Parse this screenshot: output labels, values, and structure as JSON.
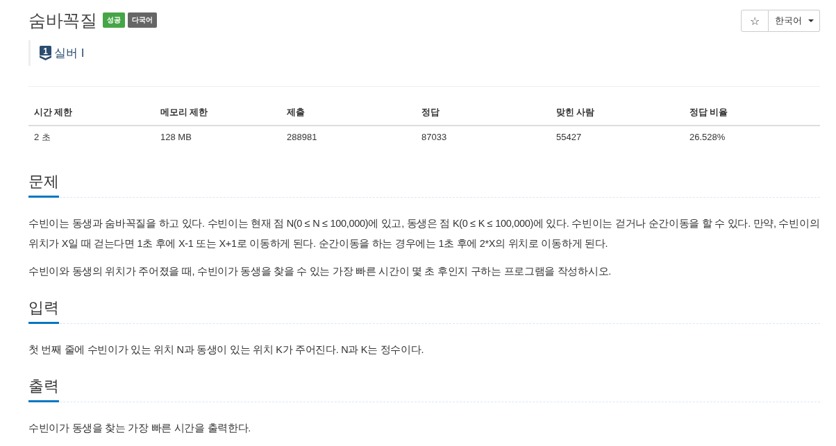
{
  "problem": {
    "title": "숨바꼭질",
    "badges": [
      {
        "label": "성공",
        "color": "#46a546"
      },
      {
        "label": "다국어",
        "color": "#666666"
      }
    ],
    "tier": {
      "rank": "1",
      "label": "실버 I"
    }
  },
  "toolbar": {
    "star": "☆",
    "language": "한국어"
  },
  "stats": {
    "columns": [
      "시간 제한",
      "메모리 제한",
      "제출",
      "정답",
      "맞힌 사람",
      "정답 비율"
    ],
    "rows": [
      [
        "2 초",
        "128 MB",
        "288981",
        "87033",
        "55427",
        "26.528%"
      ]
    ]
  },
  "sections": [
    {
      "heading": "문제",
      "paragraphs": [
        "수빈이는 동생과 숨바꼭질을 하고 있다. 수빈이는 현재 점 N(0 ≤ N ≤ 100,000)에 있고, 동생은 점 K(0 ≤ K ≤ 100,000)에 있다. 수빈이는 걷거나 순간이동을 할 수 있다. 만약, 수빈이의 위치가 X일 때 걷는다면 1초 후에 X-1 또는 X+1로 이동하게 된다. 순간이동을 하는 경우에는 1초 후에 2*X의 위치로 이동하게 된다.",
        "수빈이와 동생의 위치가 주어졌을 때, 수빈이가 동생을 찾을 수 있는 가장 빠른 시간이 몇 초 후인지 구하는 프로그램을 작성하시오."
      ]
    },
    {
      "heading": "입력",
      "paragraphs": [
        "첫 번째 줄에 수빈이가 있는 위치 N과 동생이 있는 위치 K가 주어진다. N과 K는 정수이다."
      ]
    },
    {
      "heading": "출력",
      "paragraphs": [
        "수빈이가 동생을 찾는 가장 빠른 시간을 출력한다."
      ]
    }
  ]
}
